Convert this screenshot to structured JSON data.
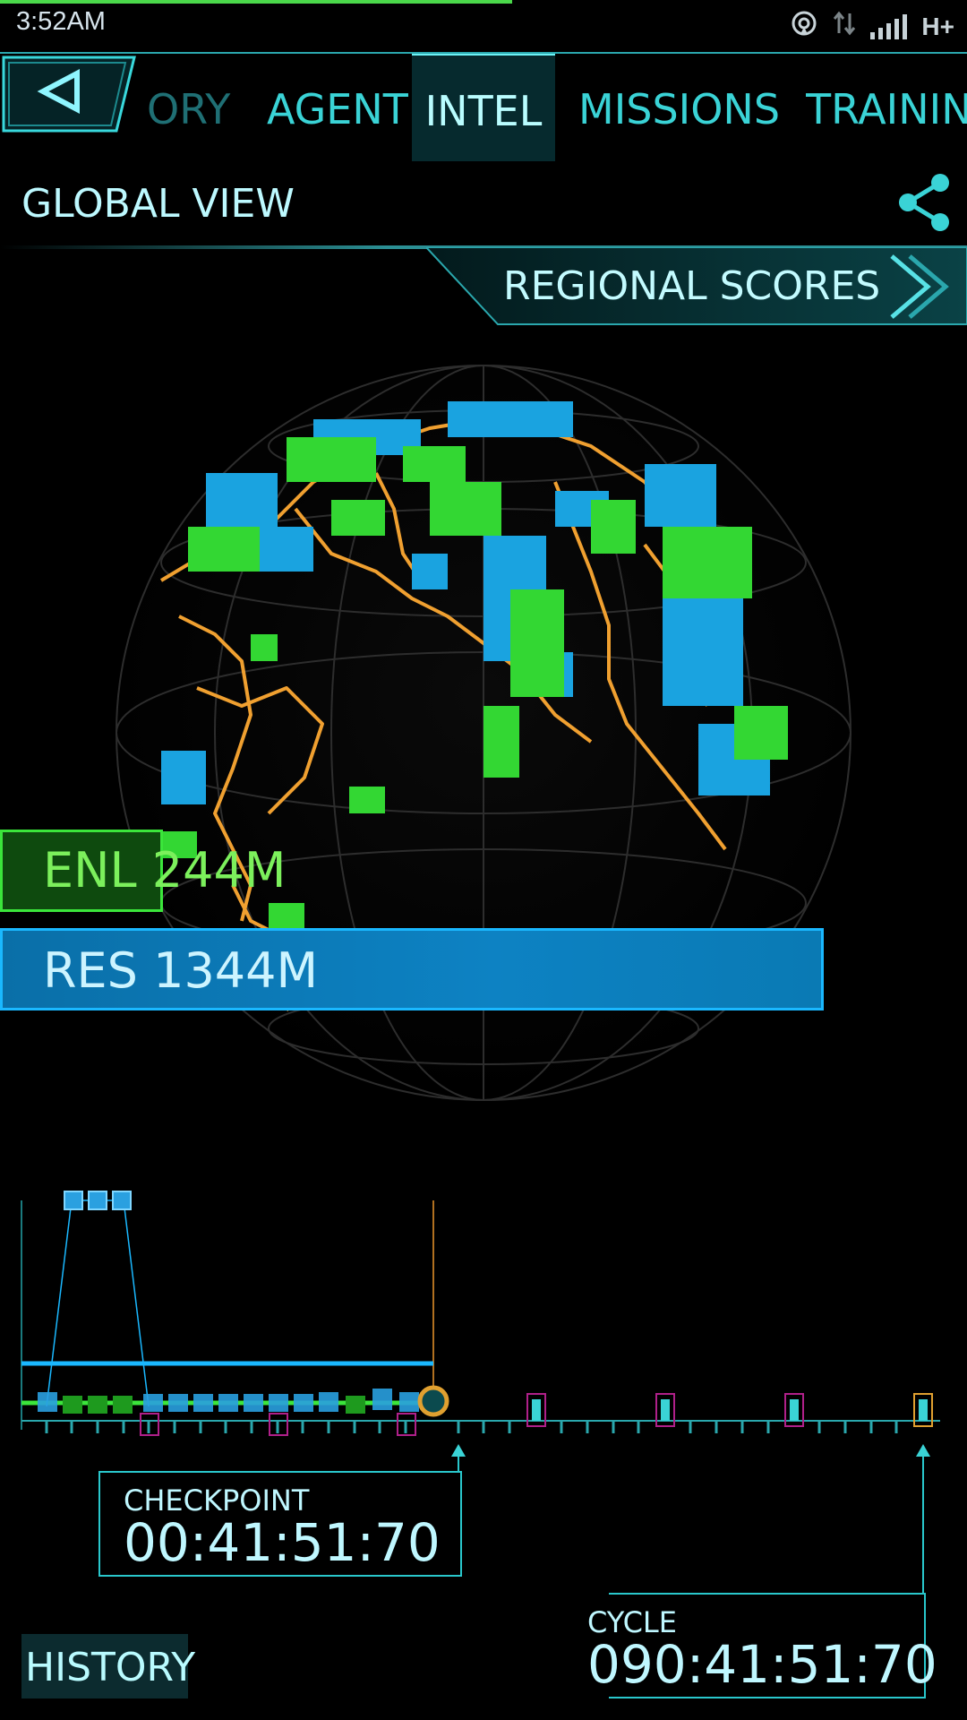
{
  "status_bar": {
    "time": "3:52AM",
    "network": "H+"
  },
  "tabs": [
    {
      "label": "ORY"
    },
    {
      "label": "AGENT"
    },
    {
      "label": "INTEL"
    },
    {
      "label": "MISSIONS"
    },
    {
      "label": "TRAINING"
    }
  ],
  "active_tab": "INTEL",
  "header": {
    "title": "GLOBAL VIEW",
    "regional_scores": "REGIONAL SCORES"
  },
  "scores": {
    "enl": "ENL 244M",
    "res": "RES 1344M",
    "enl_value_m": 244,
    "res_value_m": 1344
  },
  "timeline": {
    "checkpoint_label": "CHECKPOINT",
    "checkpoint_value": "00:41:51:70",
    "cycle_label": "CYCLE",
    "cycle_value": "090:41:51:70"
  },
  "history_button": "HISTORY",
  "colors": {
    "accent": "#3ad3d6",
    "enlightened": "#3be53b",
    "resistance": "#1ab8ff",
    "map_lines": "#f0a030"
  },
  "icons": {
    "back": "back-triangle-icon",
    "share": "share-icon",
    "forward": "double-chevron-right-icon"
  }
}
